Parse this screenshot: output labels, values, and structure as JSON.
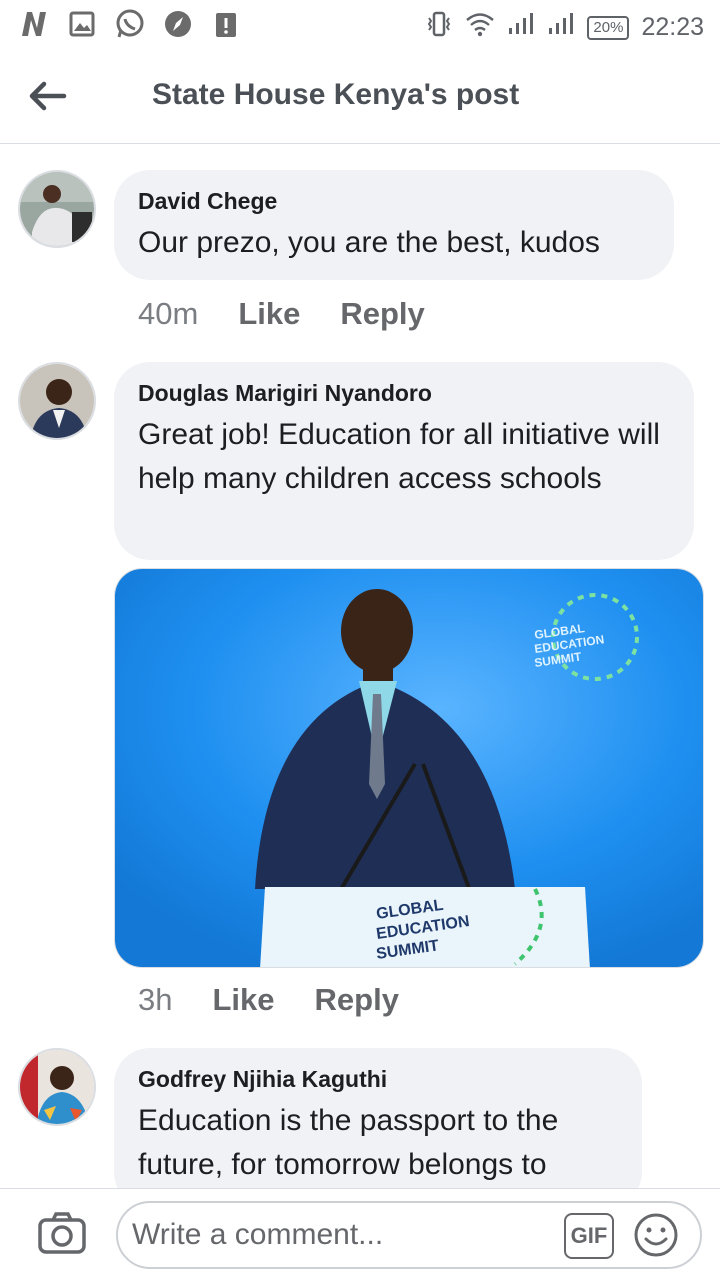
{
  "status_bar": {
    "icons": [
      "netflix-n-icon",
      "gallery-icon",
      "whatsapp-icon",
      "compass-icon",
      "download-warning-icon"
    ],
    "right_icons": [
      "vibrate-icon",
      "wifi-icon",
      "signal-icon",
      "signal-icon"
    ],
    "battery": "20%",
    "time": "22:23"
  },
  "header": {
    "title": "State House Kenya's post",
    "back_icon": "back-arrow-icon"
  },
  "comments": [
    {
      "author": "David Chege",
      "text": "Our prezo, you are the best, kudos",
      "time": "40m",
      "like": "Like",
      "reply": "Reply"
    },
    {
      "author": "Douglas Marigiri Nyandoro",
      "text": "Great job! Education for all initiative will help many children access schools",
      "time": "3h",
      "like": "Like",
      "reply": "Reply",
      "photo": {
        "banner_line1": "GLOBAL",
        "banner_line2": "EDUCATION",
        "banner_line3": "SUMMIT",
        "podium_line1": "GLOBAL",
        "podium_line2": "EDUCATION",
        "podium_line3": "SUMMIT"
      }
    },
    {
      "author": "Godfrey Njihia Kaguthi",
      "text": "Education is the passport to the future, for tomorrow belongs to"
    }
  ],
  "composer": {
    "placeholder": "Write a comment...",
    "gif_label": "GIF",
    "camera_icon": "camera-icon",
    "emoji_icon": "emoji-icon"
  },
  "colors": {
    "bubble": "#f0f2f5",
    "secondary_text": "#65676b",
    "photo_blue": "#1e8ff0"
  }
}
